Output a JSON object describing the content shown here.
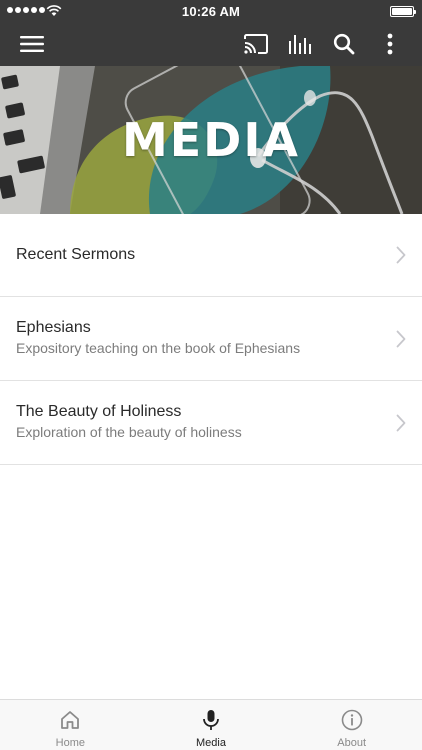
{
  "status_bar": {
    "time": "10:26 AM"
  },
  "app_bar": {
    "icons": [
      "menu-icon",
      "cast-icon",
      "equalizer-icon",
      "search-icon",
      "more-vert-icon"
    ]
  },
  "hero": {
    "title": "MEDIA"
  },
  "list": {
    "items": [
      {
        "title": "Recent Sermons",
        "subtitle": ""
      },
      {
        "title": "Ephesians",
        "subtitle": "Expository teaching on the book of Ephesians"
      },
      {
        "title": "The Beauty of Holiness",
        "subtitle": "Exploration of the beauty of holiness"
      }
    ]
  },
  "tab_bar": {
    "tabs": [
      {
        "label": "Home",
        "icon": "home-icon",
        "active": false
      },
      {
        "label": "Media",
        "icon": "microphone-icon",
        "active": true
      },
      {
        "label": "About",
        "icon": "info-icon",
        "active": false
      }
    ]
  },
  "colors": {
    "bar_background": "#3a3a3a",
    "hero_teal": "#2a7f86",
    "hero_olive": "#9aa640",
    "active_tab": "#222222",
    "inactive_tab": "#8a8a8a"
  }
}
